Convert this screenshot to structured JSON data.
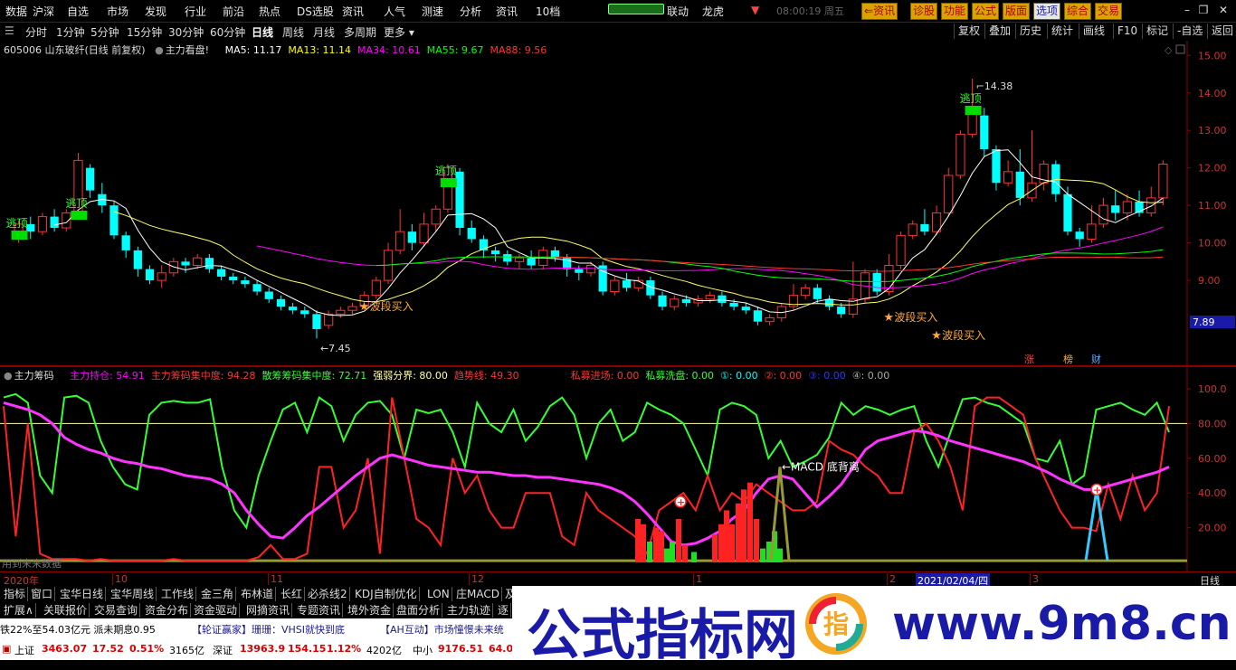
{
  "topbar": {
    "menus": [
      "数据",
      "沪深",
      "自选",
      "市场",
      "发现",
      "行业",
      "前沿",
      "热点",
      "DS选股",
      "资讯",
      "人气",
      "测速",
      "分析",
      "资讯",
      "10档"
    ],
    "link_label": "联动",
    "longhu_label": "龙虎",
    "time_text": "08:00:19 周五",
    "right_buttons": [
      "资讯",
      "诊股",
      "功能",
      "公式",
      "版面",
      "选项",
      "综合",
      "交易"
    ]
  },
  "toolbar": {
    "periods": [
      "分时",
      "1分钟",
      "5分钟",
      "15分钟",
      "30分钟",
      "60分钟",
      "日线",
      "周线",
      "月线",
      "多周期",
      "更多"
    ],
    "active_period": "日线",
    "right_items": [
      "复权",
      "叠加",
      "历史",
      "统计",
      "画线",
      "F10",
      "标记",
      "-自选",
      "返回"
    ]
  },
  "stock": {
    "code_name": "605006 山东玻纤(日线 前复权)",
    "indicator_name": "主力看盘!",
    "ma": [
      {
        "label": "MA5: 11.17",
        "color": "#ffffff"
      },
      {
        "label": "MA13: 11.14",
        "color": "#ffff00"
      },
      {
        "label": "MA34: 10.61",
        "color": "#ff00ff"
      },
      {
        "label": "MA55: 9.67",
        "color": "#00ff00"
      },
      {
        "label": "MA88: 9.56",
        "color": "#ff3333"
      }
    ]
  },
  "price_axis": [
    "15.00",
    "14.00",
    "13.00",
    "12.00",
    "11.00",
    "10.00",
    "9.00"
  ],
  "current_price_tag": "7.89",
  "annotations": {
    "high": "14.38",
    "low": "7.45",
    "escape": "逃顶",
    "buy": "波段买入",
    "zhang": "涨",
    "bang": "榜",
    "cai": "财"
  },
  "sub": {
    "title": "主力筹码",
    "items": [
      {
        "label": "主力持仓: 54.91",
        "color": "#ff00ff"
      },
      {
        "label": "主力筹码集中度: 94.28",
        "color": "#ff3333"
      },
      {
        "label": "散筹筹码集中度: 72.71",
        "color": "#33ff33"
      },
      {
        "label": "强弱分界: 80.00",
        "color": "#ffffaa"
      },
      {
        "label": "趋势线: 49.30",
        "color": "#ff3333"
      },
      {
        "label": "私募进场: 0.00",
        "color": "#ff3333"
      },
      {
        "label": "私募洗盘: 0.00",
        "color": "#33ff33"
      },
      {
        "label": "①: 0.00",
        "color": "#00ffff"
      },
      {
        "label": "②: 0.00",
        "color": "#ff3333"
      },
      {
        "label": "③: 0.00",
        "color": "#3333ff"
      },
      {
        "label": "④: 0.00",
        "color": "#aaaaaa"
      }
    ],
    "axis": [
      "100.0",
      "80.00",
      "60.00",
      "40.00",
      "20.00"
    ],
    "macd_label": "MACD 底背离",
    "footer_text": "用到未来数据"
  },
  "dates": {
    "year": "2020年",
    "months": [
      "10",
      "11",
      "12",
      "1",
      "2",
      "3"
    ],
    "highlight": "2021/02/04/四",
    "period_label": "日线"
  },
  "tabs1": [
    "指标",
    "窗口",
    "宝华日线",
    "宝华周线",
    "工作线",
    "金三角",
    "布林道",
    "长红",
    "必杀线2",
    "KDJ自制优化",
    "LON",
    "庄MACD",
    "及"
  ],
  "tabs2": [
    "扩展∧",
    "关联报价",
    "交易查询",
    "资金分布",
    "资金驱动",
    "网摘资讯",
    "专题资讯",
    "境外资金",
    "盘面分析",
    "主力轨迹",
    "逐"
  ],
  "news": [
    "铁22%至54.03亿元  派未期息0.95",
    "【轮证赢家】珊珊：VHSI就快到底",
    "【AH互动】市场憧憬未来统"
  ],
  "status": {
    "sh_label": "上证",
    "sh_value": "3463.07",
    "sh_change": "17.52",
    "sh_pct": "0.51%",
    "sh_amount": "3165亿",
    "sz_label": "深证",
    "sz_value": "13963.9",
    "sz_change": "154.15",
    "sz_pct": "1.12%",
    "sz_amount": "4202亿",
    "zx_label": "中小",
    "zx_value": "9176.51",
    "zx_change": "64.0"
  },
  "watermark": {
    "title": "公式指标网",
    "url": "www.9m8.cn",
    "logo_char": "指"
  },
  "chart_data": {
    "type": "candlestick",
    "price_range": [
      7.0,
      15.2
    ],
    "candles": [
      [
        10.1,
        10.5,
        10.0,
        10.6
      ],
      [
        10.5,
        10.3,
        10.1,
        10.7
      ],
      [
        10.3,
        10.7,
        10.2,
        10.8
      ],
      [
        10.7,
        10.4,
        10.3,
        10.9
      ],
      [
        10.4,
        10.8,
        10.3,
        10.9
      ],
      [
        10.8,
        12.2,
        10.8,
        12.4
      ],
      [
        12.0,
        11.4,
        11.2,
        12.1
      ],
      [
        11.3,
        11.0,
        10.8,
        11.6
      ],
      [
        11.0,
        10.2,
        10.1,
        11.1
      ],
      [
        10.2,
        9.8,
        9.6,
        10.3
      ],
      [
        9.8,
        9.3,
        9.1,
        9.9
      ],
      [
        9.3,
        9.0,
        8.9,
        9.4
      ],
      [
        9.0,
        9.2,
        8.8,
        9.4
      ],
      [
        9.2,
        9.5,
        9.1,
        9.6
      ],
      [
        9.5,
        9.4,
        9.2,
        9.6
      ],
      [
        9.4,
        9.6,
        9.3,
        9.7
      ],
      [
        9.6,
        9.3,
        9.2,
        9.7
      ],
      [
        9.3,
        9.1,
        9.0,
        9.4
      ],
      [
        9.1,
        9.0,
        8.9,
        9.2
      ],
      [
        9.0,
        8.9,
        8.8,
        9.1
      ],
      [
        8.9,
        8.7,
        8.6,
        9.0
      ],
      [
        8.7,
        8.5,
        8.4,
        8.8
      ],
      [
        8.5,
        8.3,
        8.2,
        8.6
      ],
      [
        8.3,
        8.2,
        8.1,
        8.4
      ],
      [
        8.2,
        8.1,
        8.0,
        8.3
      ],
      [
        8.1,
        7.7,
        7.45,
        8.2
      ],
      [
        7.8,
        8.1,
        7.7,
        8.2
      ],
      [
        8.1,
        8.2,
        8.0,
        8.3
      ],
      [
        8.2,
        8.3,
        8.1,
        8.4
      ],
      [
        8.3,
        8.6,
        8.2,
        8.7
      ],
      [
        8.6,
        9.0,
        8.5,
        9.1
      ],
      [
        9.0,
        9.8,
        8.9,
        10.0
      ],
      [
        9.8,
        10.3,
        9.7,
        10.9
      ],
      [
        10.3,
        10.0,
        9.8,
        10.5
      ],
      [
        10.0,
        10.5,
        9.9,
        10.8
      ],
      [
        10.5,
        10.9,
        10.3,
        11.0
      ],
      [
        10.9,
        12.0,
        10.8,
        12.1
      ],
      [
        11.9,
        10.4,
        10.2,
        12.0
      ],
      [
        10.4,
        10.1,
        10.0,
        10.6
      ],
      [
        10.1,
        9.8,
        9.6,
        10.2
      ],
      [
        9.8,
        9.7,
        9.5,
        9.9
      ],
      [
        9.7,
        9.5,
        9.4,
        9.8
      ],
      [
        9.5,
        9.6,
        9.3,
        9.7
      ],
      [
        9.6,
        9.4,
        9.3,
        9.8
      ],
      [
        9.4,
        9.8,
        9.3,
        9.9
      ],
      [
        9.8,
        9.6,
        9.5,
        9.9
      ],
      [
        9.6,
        9.3,
        9.1,
        9.7
      ],
      [
        9.3,
        9.2,
        9.0,
        9.4
      ],
      [
        9.2,
        9.4,
        9.1,
        9.5
      ],
      [
        9.4,
        8.7,
        8.6,
        9.5
      ],
      [
        8.7,
        9.0,
        8.6,
        9.1
      ],
      [
        9.0,
        8.8,
        8.7,
        9.2
      ],
      [
        8.8,
        9.0,
        8.7,
        9.1
      ],
      [
        9.0,
        8.6,
        8.5,
        9.1
      ],
      [
        8.6,
        8.3,
        8.2,
        8.7
      ],
      [
        8.3,
        8.5,
        8.2,
        8.6
      ],
      [
        8.5,
        8.4,
        8.3,
        8.6
      ],
      [
        8.4,
        8.5,
        8.3,
        8.6
      ],
      [
        8.5,
        8.6,
        8.4,
        8.7
      ],
      [
        8.6,
        8.4,
        8.3,
        8.7
      ],
      [
        8.4,
        8.3,
        8.2,
        8.5
      ],
      [
        8.3,
        8.2,
        8.1,
        8.4
      ],
      [
        8.2,
        7.9,
        7.8,
        8.3
      ],
      [
        7.9,
        8.0,
        7.8,
        8.1
      ],
      [
        8.0,
        8.3,
        7.9,
        8.4
      ],
      [
        8.3,
        8.6,
        8.2,
        8.9
      ],
      [
        8.6,
        8.8,
        8.5,
        8.9
      ],
      [
        8.8,
        8.5,
        8.4,
        8.9
      ],
      [
        8.5,
        8.3,
        8.2,
        8.6
      ],
      [
        8.3,
        8.1,
        8.0,
        8.4
      ],
      [
        8.1,
        8.5,
        8.0,
        9.5
      ],
      [
        8.5,
        9.2,
        8.4,
        9.3
      ],
      [
        9.2,
        8.7,
        8.6,
        9.3
      ],
      [
        8.7,
        9.4,
        8.6,
        9.7
      ],
      [
        9.4,
        10.2,
        9.3,
        10.3
      ],
      [
        10.2,
        10.5,
        10.1,
        10.6
      ],
      [
        10.5,
        10.3,
        10.2,
        10.9
      ],
      [
        10.3,
        10.8,
        10.2,
        11.0
      ],
      [
        10.8,
        11.8,
        10.7,
        12.0
      ],
      [
        11.8,
        12.9,
        11.7,
        13.0
      ],
      [
        12.9,
        13.5,
        12.8,
        14.38
      ],
      [
        13.4,
        12.5,
        12.3,
        13.6
      ],
      [
        12.5,
        11.6,
        11.4,
        12.6
      ],
      [
        11.6,
        11.9,
        11.5,
        12.2
      ],
      [
        11.9,
        11.2,
        11.0,
        12.5
      ],
      [
        11.2,
        11.6,
        11.1,
        13.0
      ],
      [
        11.6,
        12.1,
        11.4,
        12.2
      ],
      [
        12.1,
        11.3,
        11.1,
        12.2
      ],
      [
        11.3,
        10.3,
        10.2,
        11.5
      ],
      [
        10.3,
        10.1,
        9.9,
        10.4
      ],
      [
        10.1,
        10.5,
        10.0,
        11.0
      ],
      [
        10.5,
        11.0,
        10.4,
        11.2
      ],
      [
        11.0,
        10.8,
        10.6,
        11.4
      ],
      [
        10.8,
        11.1,
        10.6,
        11.3
      ],
      [
        11.1,
        10.8,
        10.7,
        11.4
      ],
      [
        10.8,
        11.2,
        10.7,
        11.5
      ],
      [
        11.2,
        12.1,
        11.0,
        12.2
      ]
    ]
  }
}
